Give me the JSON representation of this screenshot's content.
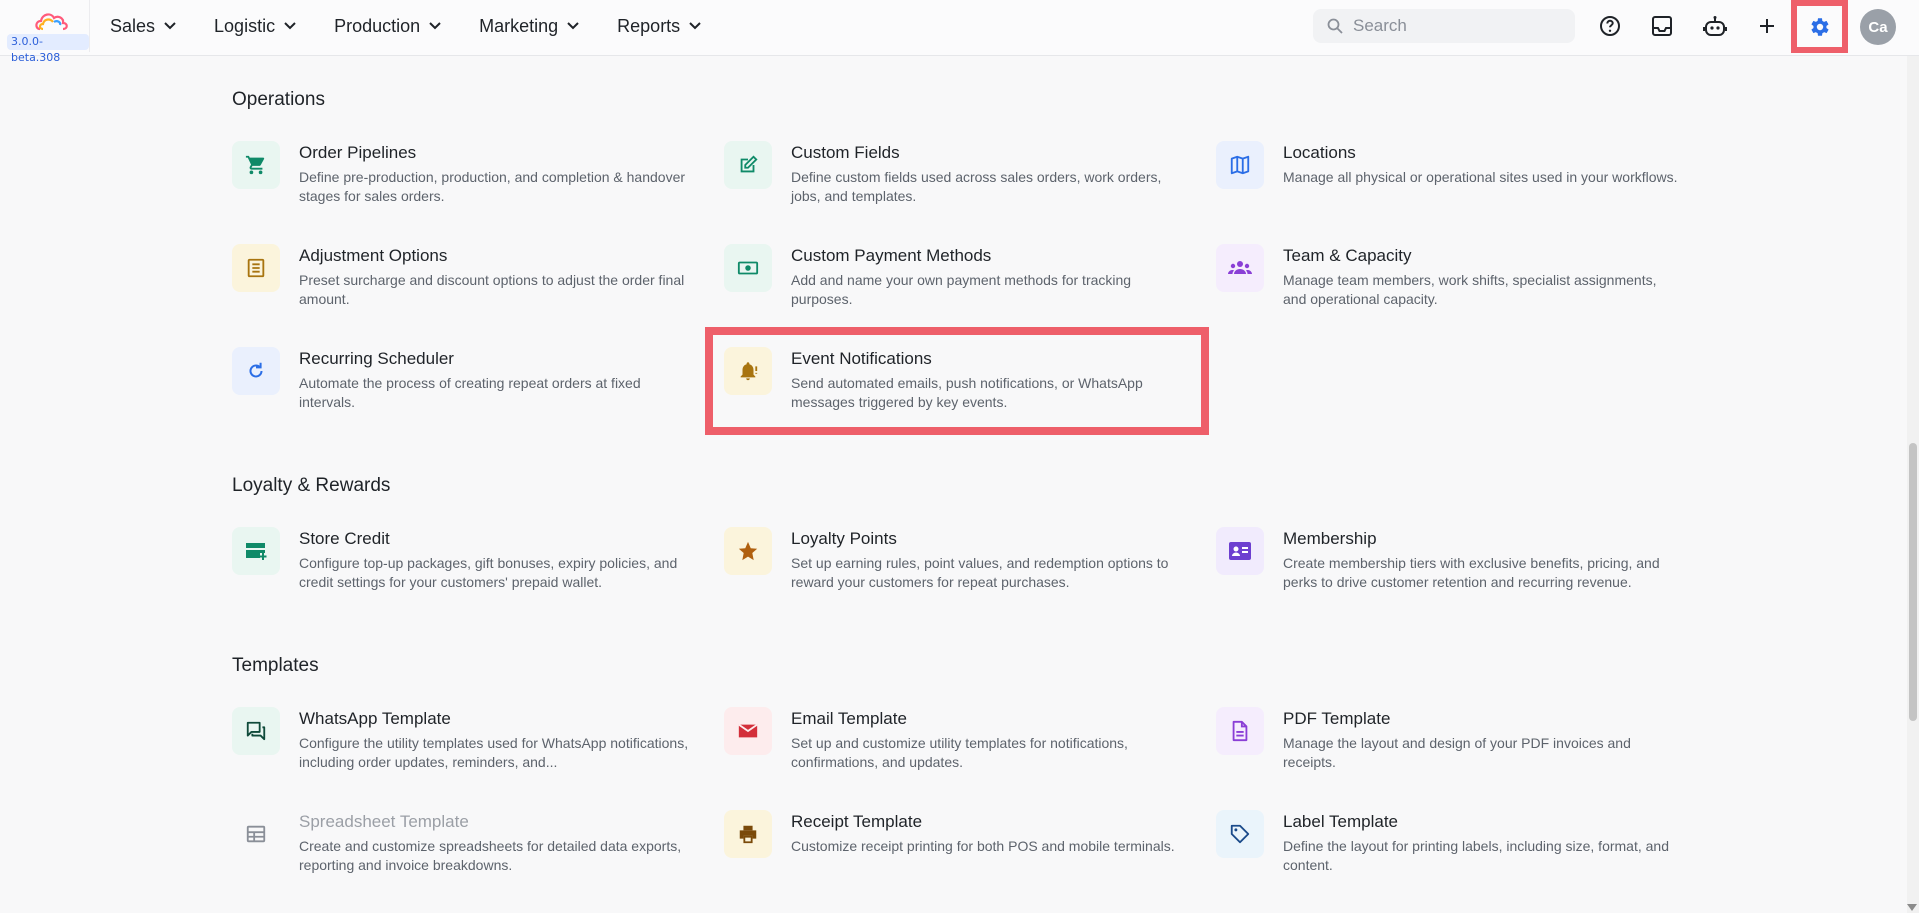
{
  "app": {
    "version": "3.0.0-beta.308"
  },
  "nav": [
    {
      "label": "Sales"
    },
    {
      "label": "Logistic"
    },
    {
      "label": "Production"
    },
    {
      "label": "Marketing"
    },
    {
      "label": "Reports"
    }
  ],
  "search": {
    "placeholder": "Search",
    "value": ""
  },
  "user": {
    "initials": "Ca"
  },
  "colors": {
    "highlight": "#ee5f6a",
    "accent": "#2b6ee6"
  },
  "sections": {
    "operations": {
      "title": "Operations",
      "cards": [
        {
          "title": "Order Pipelines",
          "desc": "Define pre-production, production, and completion & handover stages for sales orders.",
          "icon": "cart-icon"
        },
        {
          "title": "Custom Fields",
          "desc": "Define custom fields used across sales orders, work orders, jobs, and templates.",
          "icon": "edit-icon"
        },
        {
          "title": "Locations",
          "desc": "Manage all physical or operational sites used in your workflows.",
          "icon": "map-icon"
        },
        {
          "title": "Adjustment Options",
          "desc": "Preset surcharge and discount options to adjust the order final amount.",
          "icon": "list-icon"
        },
        {
          "title": "Custom Payment Methods",
          "desc": "Add and name your own payment methods for tracking purposes.",
          "icon": "money-icon"
        },
        {
          "title": "Team & Capacity",
          "desc": "Manage team members, work shifts, specialist assignments, and operational capacity.",
          "icon": "group-icon"
        },
        {
          "title": "Recurring Scheduler",
          "desc": "Automate the process of creating repeat orders at fixed intervals.",
          "icon": "refresh-icon"
        },
        {
          "title": "Event Notifications",
          "desc": "Send automated emails, push notifications, or WhatsApp messages triggered by key events.",
          "icon": "bell-alert-icon"
        }
      ]
    },
    "loyalty": {
      "title": "Loyalty & Rewards",
      "cards": [
        {
          "title": "Store Credit",
          "desc": "Configure top-up packages, gift bonuses, expiry policies, and credit settings for your customers' prepaid wallet.",
          "icon": "card-add-icon"
        },
        {
          "title": "Loyalty Points",
          "desc": "Set up earning rules, point values, and redemption options to reward your customers for repeat purchases.",
          "icon": "star-icon"
        },
        {
          "title": "Membership",
          "desc": "Create membership tiers with exclusive benefits, pricing, and perks to drive customer retention and recurring revenue.",
          "icon": "id-card-icon"
        }
      ]
    },
    "templates": {
      "title": "Templates",
      "cards": [
        {
          "title": "WhatsApp Template",
          "desc": "Configure the utility templates used for WhatsApp notifications, including order updates, reminders, and...",
          "icon": "chat-icon"
        },
        {
          "title": "Email Template",
          "desc": "Set up and customize utility templates for notifications, confirmations, and updates.",
          "icon": "mail-icon"
        },
        {
          "title": "PDF Template",
          "desc": "Manage the layout and design of your PDF invoices and receipts.",
          "icon": "document-icon"
        },
        {
          "title": "Spreadsheet Template",
          "desc": "Create and customize spreadsheets for detailed data exports, reporting and invoice breakdowns.",
          "icon": "table-icon"
        },
        {
          "title": "Receipt Template",
          "desc": "Customize receipt printing for both POS and mobile terminals.",
          "icon": "printer-icon"
        },
        {
          "title": "Label Template",
          "desc": "Define the layout for printing labels, including size, format, and content.",
          "icon": "tag-icon"
        }
      ]
    }
  }
}
